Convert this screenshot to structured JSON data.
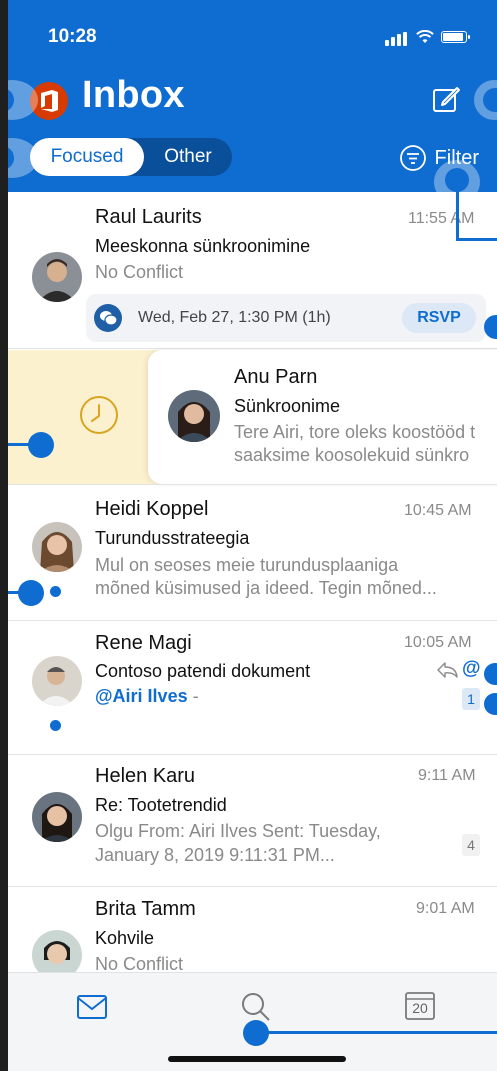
{
  "status_bar": {
    "time": "10:28"
  },
  "header": {
    "title": "Inbox",
    "tabs": {
      "focused": "Focused",
      "other": "Other"
    },
    "filter_label": "Filter"
  },
  "messages": [
    {
      "sender": "Raul Laurits",
      "subject": "Meeskonna sünkroonimine",
      "preview": "No Conflict",
      "time": "11:55 AM",
      "event": {
        "text": "Wed, Feb 27, 1:30 PM (1h)",
        "action": "RSVP"
      }
    },
    {
      "sender": "Anu Parn",
      "subject": "Sünkroonime",
      "preview_line1": "Tere Airi, tore oleks koostööd t",
      "preview_line2": "saaksime koosolekuid sünkro"
    },
    {
      "sender": "Heidi Koppel",
      "subject": "Turundusstrateegia",
      "preview_line1": "Mul on seoses meie turundusplaaniga",
      "preview_line2": "mõned küsimused ja ideed. Tegin mõned...",
      "time": "10:45 AM"
    },
    {
      "sender": "Rene Magi",
      "subject": "Contoso patendi dokument",
      "mention": "@Airi Ilves",
      "mention_suffix": "-",
      "time": "10:05 AM",
      "mention_symbol": "@",
      "count": "1"
    },
    {
      "sender": "Helen Karu",
      "subject": "Re: Tootetrendid",
      "preview_line1": "Olgu From: Airi Ilves Sent: Tuesday,",
      "preview_line2": "January 8, 2019 9:11:31 PM...",
      "time": "9:11 AM",
      "count": "4"
    },
    {
      "sender": "Brita Tamm",
      "subject": "Kohvile",
      "preview": "No Conflict",
      "time": "9:01 AM"
    }
  ],
  "tabbar": {
    "calendar_day": "20"
  },
  "colors": {
    "accent": "#0f6cd0",
    "snooze_bg": "#fbf1cf",
    "office_red": "#d83b01"
  },
  "icons": [
    "office-logo-icon",
    "compose-icon",
    "filter-icon",
    "chat-icon",
    "clock-icon",
    "reply-icon",
    "mail-icon",
    "search-icon",
    "calendar-icon"
  ]
}
